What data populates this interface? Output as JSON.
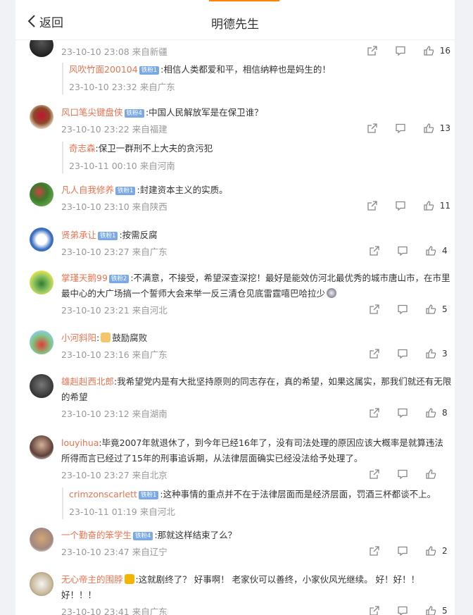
{
  "header": {
    "back_label": "返回",
    "title": "明德先生"
  },
  "comments": [
    {
      "username": "",
      "badge": "",
      "text": "",
      "meta": "23-10-10 23:08 来自新疆",
      "likes": "16",
      "reply": {
        "username": "风吹竹面200104",
        "badge": "铁粉1",
        "text": ":相信人类都爱和平，相信纳粹也是妈生的！",
        "meta": "23-10-10 23:32 来自广东"
      }
    },
    {
      "username": "风口笔尖键盘侠",
      "badge": "铁粉4",
      "text": ":中国人民解放军是在保卫谁？",
      "meta": "23-10-10 23:22 来自福建",
      "likes": "13",
      "reply": {
        "username": "奇志森",
        "badge": "",
        "text": ":保卫一群刑不上大夫的贪污犯",
        "meta": "23-10-11 00:10 来自河南"
      }
    },
    {
      "username": "凡人自我修养",
      "badge": "铁粉1",
      "text": ":封建资本主义的实质。",
      "meta": "23-10-10 23:10 来自陕西",
      "likes": "11"
    },
    {
      "username": "贤弟承让",
      "badge": "铁粉1",
      "text": ":按需反腐",
      "meta": "23-10-10 23:27 来自广东",
      "likes": "4"
    },
    {
      "username": "掌瑾天鹅99",
      "badge": "铁粉2",
      "text": ":不满意，不接受，希望深查深挖！最好是能效仿河北最优秀的城市唐山市，在市里最中心的大广场搞一个誓师大会来举一反三清仓见底雷霆嘻巴哈拉少",
      "meta": "23-10-10 23:21 来自河北",
      "likes": "5"
    },
    {
      "username": "小河斜阳",
      "badge": "",
      "text": "鼓励腐败",
      "meta": "23-10-10 23:16 来自广东",
      "likes": "3"
    },
    {
      "username": "雄赳赳西北郎",
      "badge": "",
      "text": ":我希望党内是有大批坚持原则的同志存在，真的希望，如果这属实，那我们就还有无限的希望",
      "meta": "23-10-10 23:12 来自湖南",
      "likes": "8"
    },
    {
      "username": "louyihua",
      "badge": "",
      "text": ":毕竟2007年就退休了，到今年已经16年了，没有司法处理的原因应该大概率是就算违法所得而言已经过了15年的刑事追诉期，从法律层面确实已经没法给予处理了。",
      "meta": "23-10-10 23:27 来自北京",
      "likes": "",
      "reply": {
        "username": "crimzonscarlett",
        "badge": "铁粉1",
        "text": ":这种事情的重点并不在于法律层面而是经济层面，罚酒三杯都谈不上。",
        "meta": "23-10-11 01:19 来自河北"
      }
    },
    {
      "username": "一个勤奋的笨学生",
      "badge": "铁粉4",
      "text": ":那就这样结束了么？",
      "meta": "23-10-10 23:47 来自辽宁",
      "likes": "2"
    },
    {
      "username": "无心帝主的围脖",
      "badge": "",
      "text": ":这就剧终了？ 好事啊！ 老家伙可以善终，小家伙风光继续。 好！好！！好！！！",
      "meta": "23-10-10 23:41 来自广东",
      "likes": "5"
    }
  ],
  "colors": {
    "accent": "#eb7350",
    "badge": "#7aa9e5",
    "meta": "#999999",
    "top_bar": "#ff8200"
  },
  "icons": {
    "back": "chevron-left-icon",
    "share": "share-icon",
    "comment": "comment-icon",
    "like": "thumbs-up-icon"
  }
}
